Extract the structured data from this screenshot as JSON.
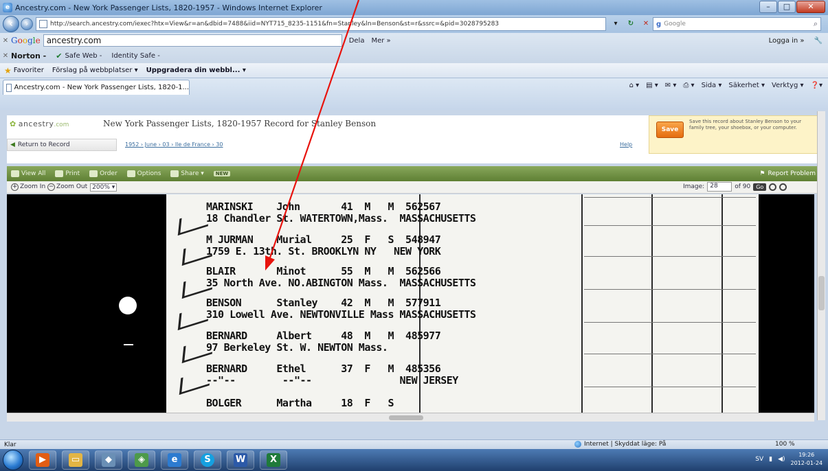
{
  "window": {
    "title": "Ancestry.com - New York Passenger Lists, 1820-1957 - Windows Internet Explorer",
    "min": "–",
    "max": "□",
    "close": "✕"
  },
  "address": {
    "url": "http://search.ancestry.com/iexec?htx=View&r=an&dbid=7488&iid=NYT715_8235-1151&fn=Stanley&ln=Benson&st=r&ssrc=&pid=3028795283",
    "search_placeholder": "Google"
  },
  "google_bar": {
    "query": "ancestry.com",
    "share": "Dela",
    "more": "Mer »",
    "sign_in": "Logga in »"
  },
  "norton_bar": {
    "brand": "Norton -",
    "safe_web": "Safe Web -",
    "identity_safe": "Identity Safe -"
  },
  "favorites": {
    "label": "Favoriter",
    "item1": "Förslag på webbplatser ▾",
    "item2": "Uppgradera din webbl... ▾"
  },
  "tab": {
    "label": "Ancestry.com - New York Passenger Lists, 1820-1..."
  },
  "commandbar": {
    "page": "Sida ▾",
    "safety": "Säkerhet ▾",
    "tools": "Verktyg ▾",
    "help": "❓▾"
  },
  "ancestry": {
    "logo_name": "ancestry",
    "logo_suffix": ".com",
    "title": "New York Passenger Lists, 1820-1957 Record for Stanley Benson",
    "return_label": "Return to Record",
    "breadcrumb": "1952 › June › 03 › Ile de France › 30",
    "help": "Help",
    "save_label": "Save",
    "save_text": "Save this record about Stanley Benson to your family tree, your shoebox, or your computer."
  },
  "viewer_bar": {
    "view_all": "View All",
    "print": "Print",
    "order": "Order",
    "options": "Options",
    "share": "Share ▾",
    "new_badge": "NEW",
    "report": "Report Problem"
  },
  "zoom_bar": {
    "zoom_in": "Zoom In",
    "zoom_out": "Zoom Out",
    "zoom_level": "200%",
    "image_label": "Image:",
    "image_number": "28",
    "of_label": "of 90",
    "go": "Go"
  },
  "records": [
    {
      "line1": "MARINSKI    John       41  M   M  562567",
      "line2": "18 Chandler St. WATERTOWN,Mass.  MASSACHUSETTS"
    },
    {
      "line1": "M JURMAN    Murial     25  F   S  548947",
      "line2": "1759 E. 13th. St. BROOKLYN NY   NEW YORK"
    },
    {
      "line1": "BLAIR       Minot      55  M   M  562566",
      "line2": "35 North Ave. NO.ABINGTON Mass.  MASSACHUSETTS"
    },
    {
      "line1": "BENSON      Stanley    42  M   M  577911",
      "line2": "310 Lowell Ave. NEWTONVILLE Mass MASSACHUSETTS"
    },
    {
      "line1": "BERNARD     Albert     48  M   M  485977",
      "line2": "97 Berkeley St. W. NEWTON Mass."
    },
    {
      "line1": "BERNARD     Ethel      37  F   M  485356",
      "line2": "--\"--        --\"--               NEW JERSEY"
    },
    {
      "line1": "BOLGER      Martha     18  F   S  ",
      "line2": ""
    }
  ],
  "statusbar": {
    "left": "Klar",
    "zone": "Internet | Skyddat läge: På",
    "zoom": "100 %"
  },
  "taskbar": {
    "lang": "SV",
    "time": "19:26",
    "date": "2012-01-24"
  }
}
